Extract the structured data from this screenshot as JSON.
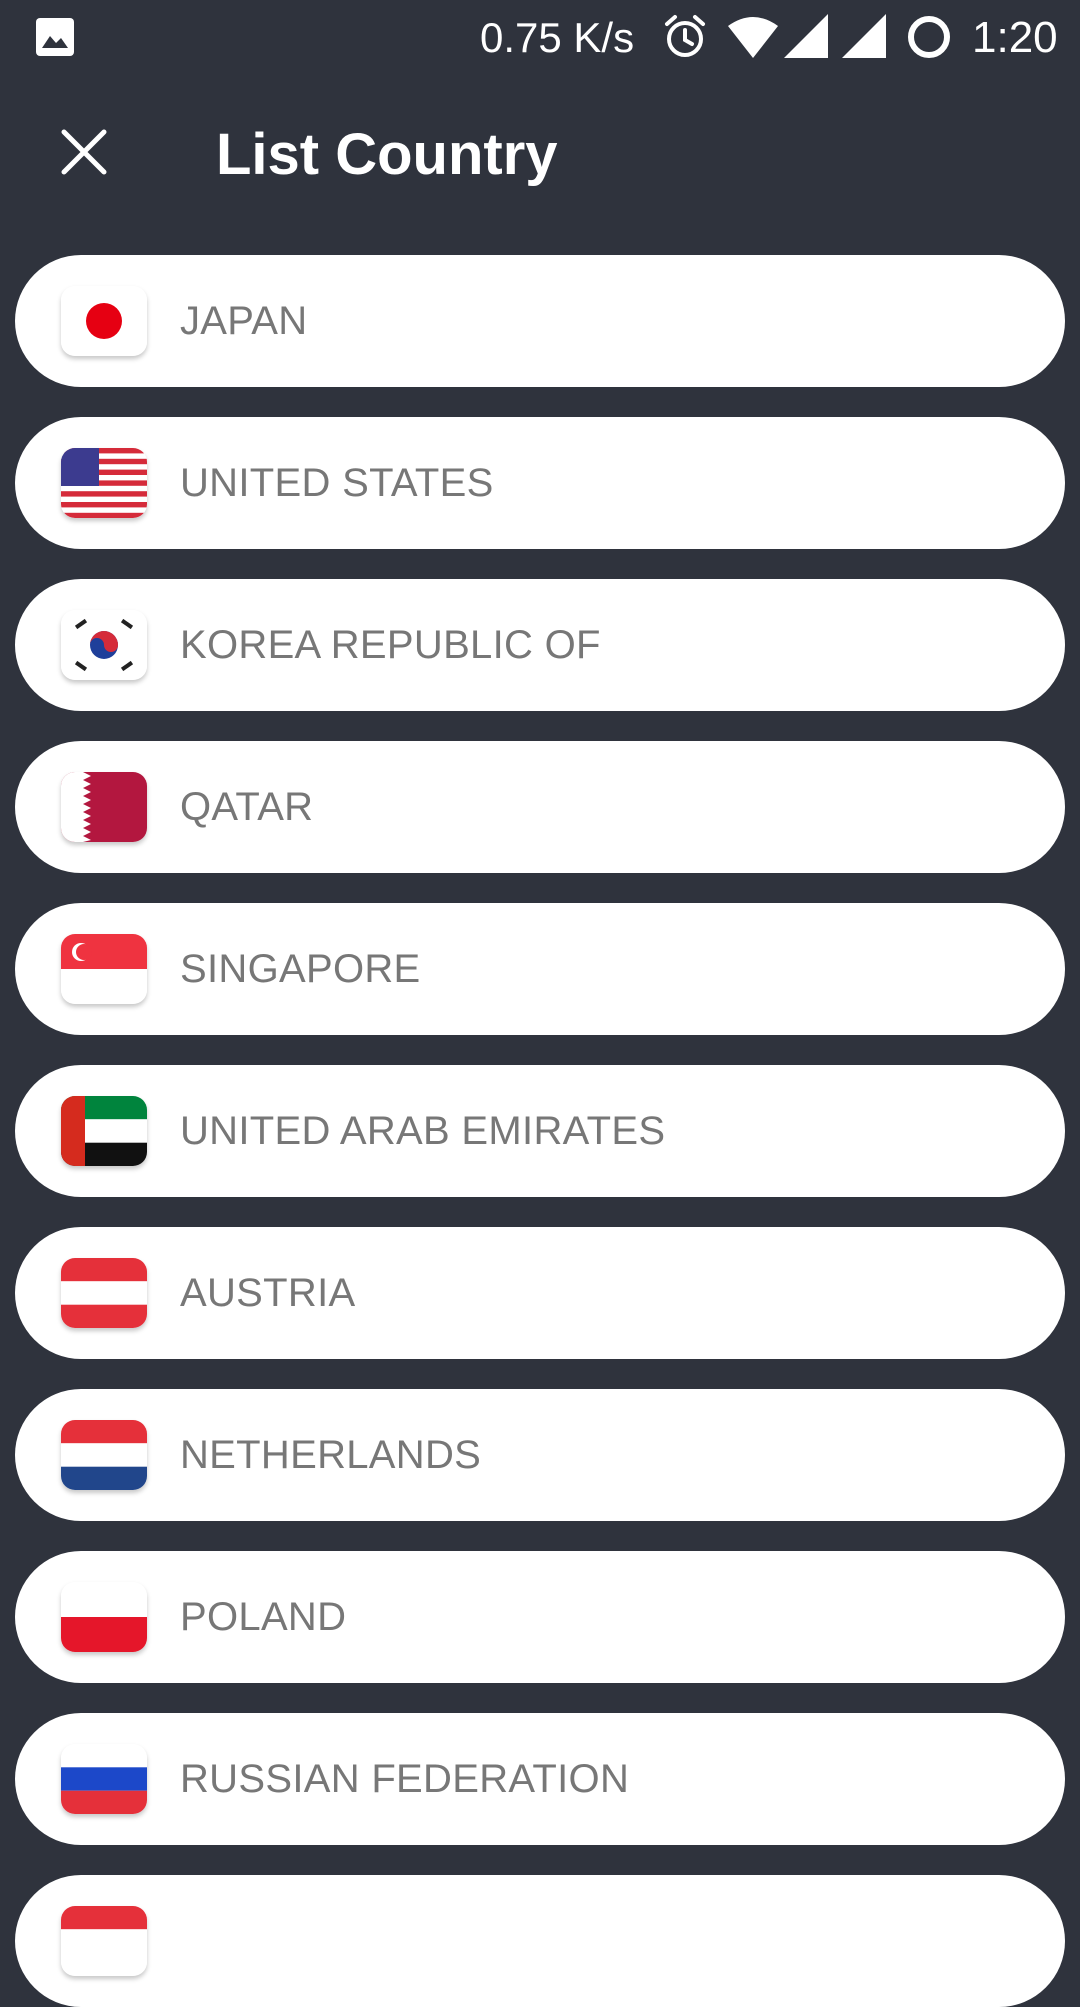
{
  "status_bar": {
    "speed": "0.75 K/s",
    "time": "1:20",
    "icons": [
      "gallery-icon",
      "alarm-icon",
      "wifi-icon",
      "signal-icon",
      "signal-icon",
      "battery-saver-icon"
    ]
  },
  "header": {
    "title": "List Country",
    "close_icon": "close-icon"
  },
  "colors": {
    "background": "#2f333d",
    "item_background": "#ffffff",
    "item_text": "#777777"
  },
  "countries": [
    {
      "name": "JAPAN",
      "flag": "japan-flag-icon"
    },
    {
      "name": "UNITED STATES",
      "flag": "united-states-flag-icon"
    },
    {
      "name": "KOREA REPUBLIC OF",
      "flag": "korea-flag-icon"
    },
    {
      "name": "QATAR",
      "flag": "qatar-flag-icon"
    },
    {
      "name": "SINGAPORE",
      "flag": "singapore-flag-icon"
    },
    {
      "name": "UNITED ARAB EMIRATES",
      "flag": "uae-flag-icon"
    },
    {
      "name": "AUSTRIA",
      "flag": "austria-flag-icon"
    },
    {
      "name": "NETHERLANDS",
      "flag": "netherlands-flag-icon"
    },
    {
      "name": "POLAND",
      "flag": "poland-flag-icon"
    },
    {
      "name": "RUSSIAN FEDERATION",
      "flag": "russia-flag-icon"
    },
    {
      "name": "",
      "flag": "partial-flag-icon"
    }
  ]
}
